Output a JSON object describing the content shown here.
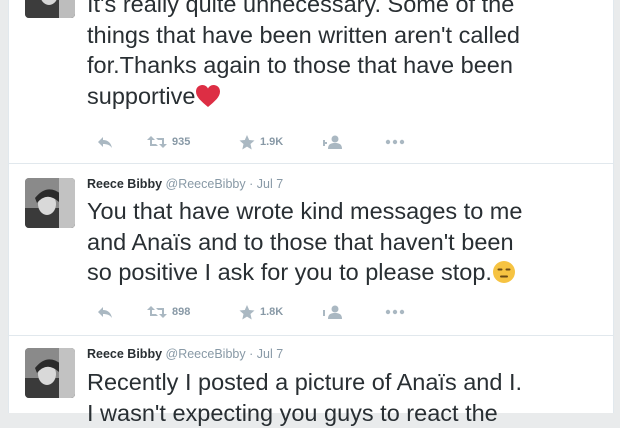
{
  "tweets": [
    {
      "fullname": "",
      "username": "",
      "time": "",
      "lines": [
        "It's really quite unnecessary. Some of the",
        "things that have been written aren't called",
        "for.Thanks again to those that have been",
        "supportive"
      ],
      "emoji": "red-heart",
      "retweets": "935",
      "favorites": "1.9K"
    },
    {
      "fullname": "Reece Bibby",
      "username": "@ReeceBibby",
      "time": "Jul 7",
      "lines": [
        "You that have wrote kind messages to me",
        "and Anaïs and to those that haven't been",
        "so positive I ask for you to please stop."
      ],
      "emoji": "expressionless-face",
      "retweets": "898",
      "favorites": "1.8K"
    },
    {
      "fullname": "Reece Bibby",
      "username": "@ReeceBibby",
      "time": "Jul 7",
      "lines": [
        "Recently I posted a picture of Anaïs and I.",
        "I wasn't expecting you guys to react the"
      ],
      "emoji": "",
      "retweets": "",
      "favorites": ""
    }
  ],
  "colors": {
    "text": "#292f33",
    "muted": "#8899a6",
    "icon": "#aab8c2",
    "heart": "#dd2e44",
    "divider": "#e1e8ed"
  },
  "separator": "·"
}
